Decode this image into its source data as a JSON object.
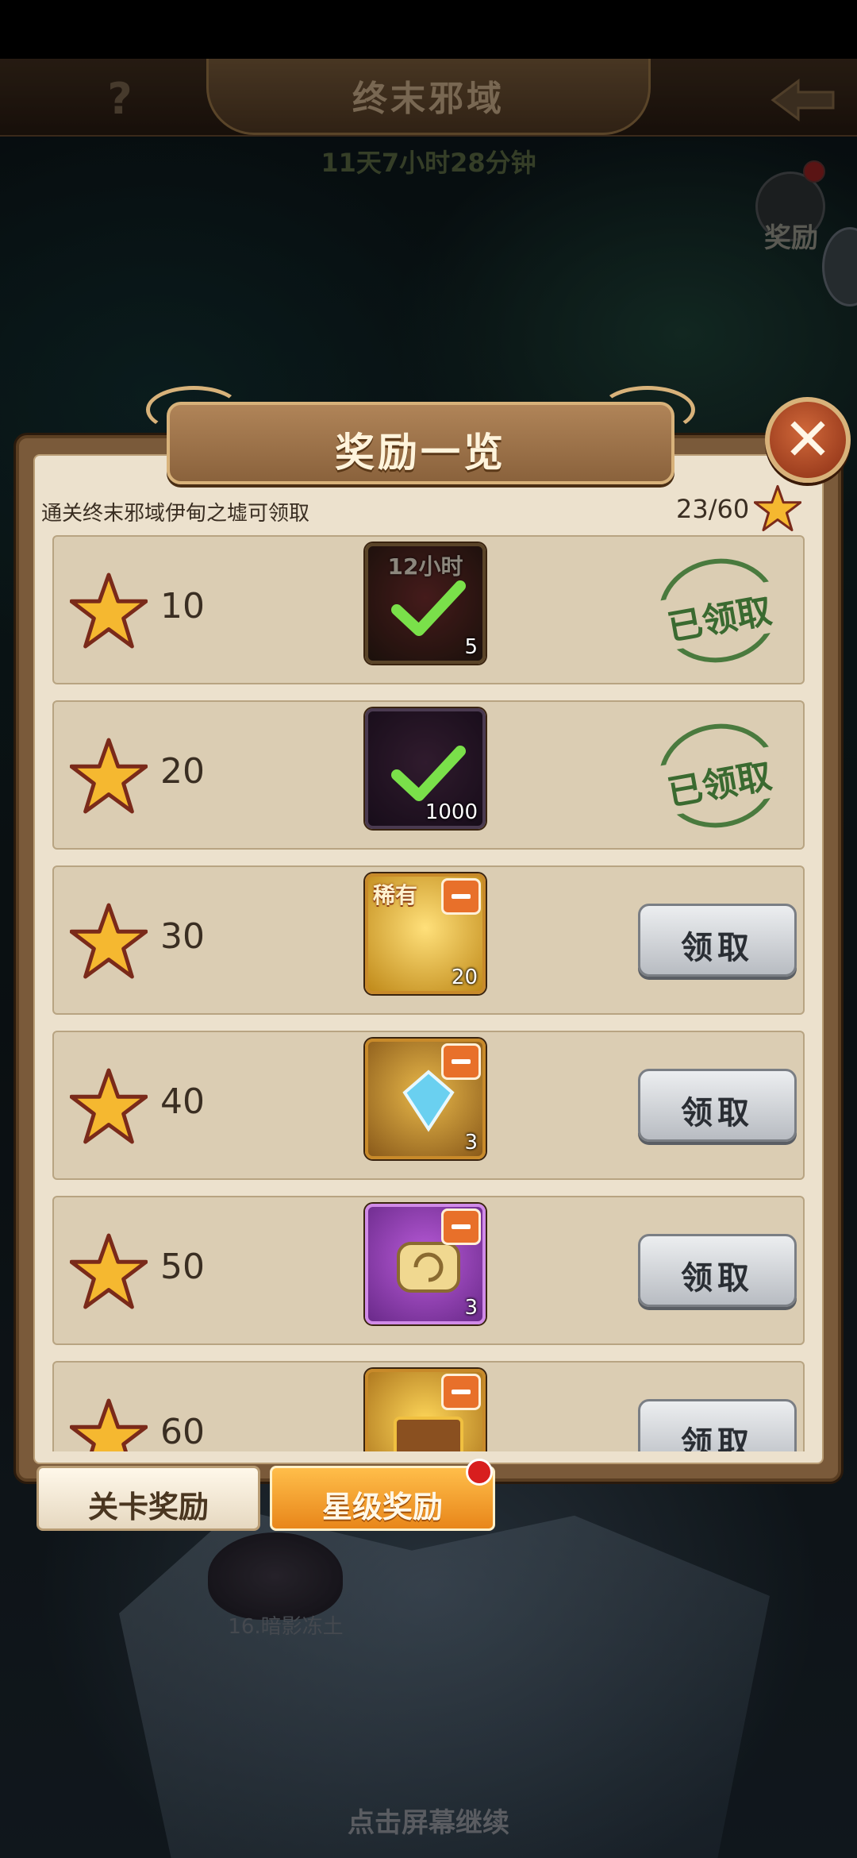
{
  "header": {
    "title": "终末邪域",
    "help_icon": "?",
    "timer": "11天7小时28分钟",
    "reward_button_label": "奖励"
  },
  "dialog": {
    "title": "奖励一览",
    "close_glyph": "✕",
    "description": "通关终末邪域伊甸之墟可领取",
    "progress": "23/60"
  },
  "rewards": [
    {
      "stars": "10",
      "item_tag": "12小时",
      "quantity": "5",
      "status": "已领取"
    },
    {
      "stars": "20",
      "item_tag": "",
      "quantity": "1000",
      "status": "已领取"
    },
    {
      "stars": "30",
      "item_tag": "稀有",
      "quantity": "20",
      "button": "领取"
    },
    {
      "stars": "40",
      "item_tag": "",
      "quantity": "3",
      "button": "领取"
    },
    {
      "stars": "50",
      "item_tag": "",
      "quantity": "3",
      "button": "领取"
    },
    {
      "stars": "60",
      "item_tag": "",
      "quantity": "",
      "button": "领取"
    }
  ],
  "tabs": {
    "level_rewards": "关卡奖励",
    "star_rewards": "星级奖励"
  },
  "map": {
    "stage_label": "16.暗影冻土",
    "continue_hint": "点击屏幕继续"
  },
  "colors": {
    "star_fill": "#f5b830",
    "claim_button": "#d0d4d8",
    "active_tab": "#f5a02a",
    "stamp_green": "#3a6a30"
  }
}
